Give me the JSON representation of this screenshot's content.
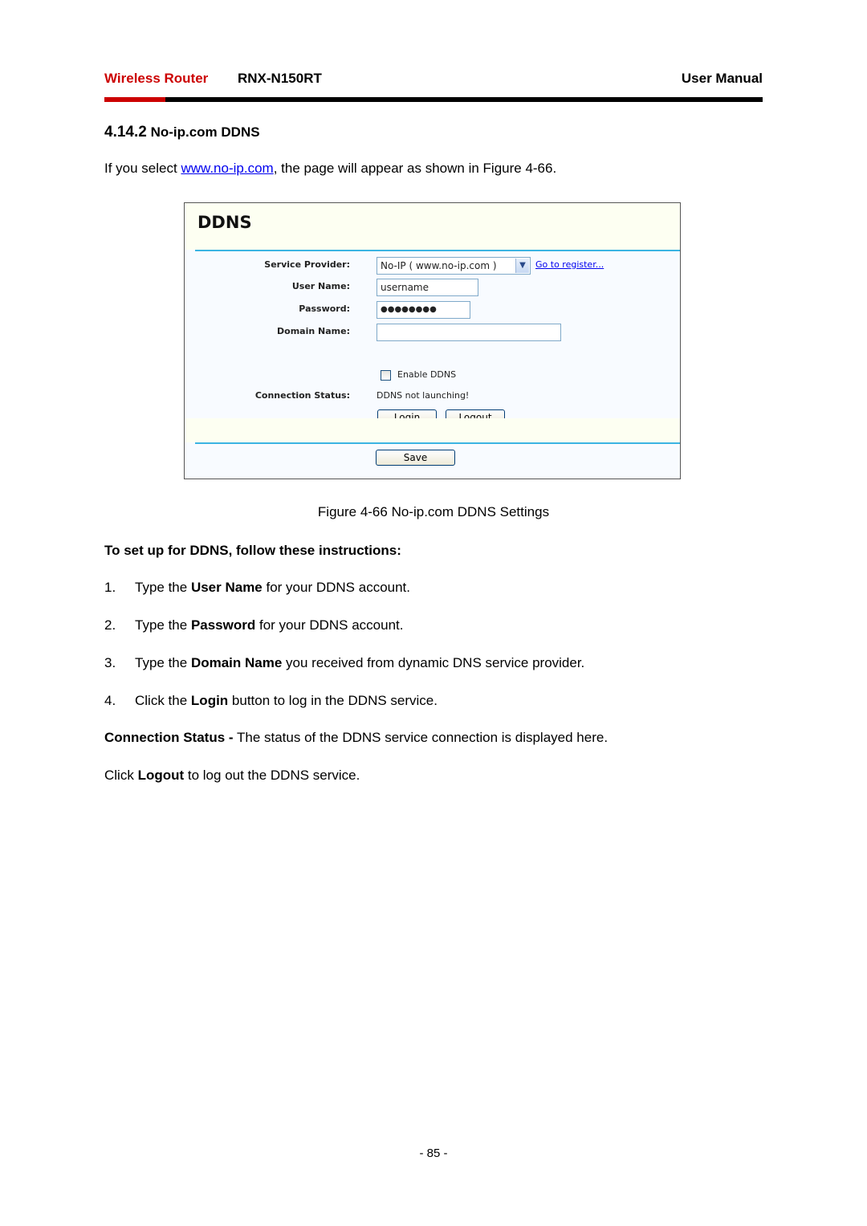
{
  "header": {
    "brand": "Wireless Router",
    "model": "RNX-N150RT",
    "doc_type": "User Manual",
    "colors": {
      "brand_red": "#cc0000",
      "bar_black": "#000000"
    }
  },
  "section": {
    "number": "4.14.2",
    "title": "No-ip.com DDNS"
  },
  "intro": {
    "before": "If you select ",
    "link": "www.no-ip.com",
    "after": ", the page will appear as shown in Figure 4-66."
  },
  "figure": {
    "title": "DDNS",
    "fields": {
      "service_provider_label": "Service Provider:",
      "service_provider_value": "No-IP ( www.no-ip.com )",
      "register_link": "Go to register...",
      "user_name_label": "User Name:",
      "user_name_value": "username",
      "password_label": "Password:",
      "password_value": "●●●●●●●●",
      "domain_name_label": "Domain Name:",
      "domain_name_value": "",
      "enable_ddns_label": "Enable DDNS",
      "enable_ddns_checked": false,
      "connection_status_label": "Connection Status:",
      "connection_status_value": "DDNS not launching!"
    },
    "buttons": {
      "login": "Login",
      "logout": "Logout",
      "save": "Save"
    },
    "colors": {
      "accent_line": "#3bb4e2",
      "header_bg": "#fdfff2"
    }
  },
  "caption": "Figure 4-66 No-ip.com DDNS Settings",
  "instructions_heading": "To set up for DDNS, follow these instructions:",
  "steps": [
    {
      "num": "1.",
      "pre": "Type the ",
      "bold": "User Name",
      "post": " for your DDNS account."
    },
    {
      "num": "2.",
      "pre": "Type the ",
      "bold": "Password",
      "post": " for your DDNS account."
    },
    {
      "num": "3.",
      "pre": "Type the ",
      "bold": "Domain Name",
      "post": " you received from dynamic DNS service provider."
    },
    {
      "num": "4.",
      "pre": "Click the ",
      "bold": "Login",
      "post": " button to log in the DDNS service."
    }
  ],
  "connection_status_note": {
    "bold": "Connection Status -",
    "text": " The status of the DDNS service connection is displayed here."
  },
  "logout_note": {
    "pre": "Click ",
    "bold": "Logout",
    "post": " to log out the DDNS service."
  },
  "page_number": "- 85 -"
}
